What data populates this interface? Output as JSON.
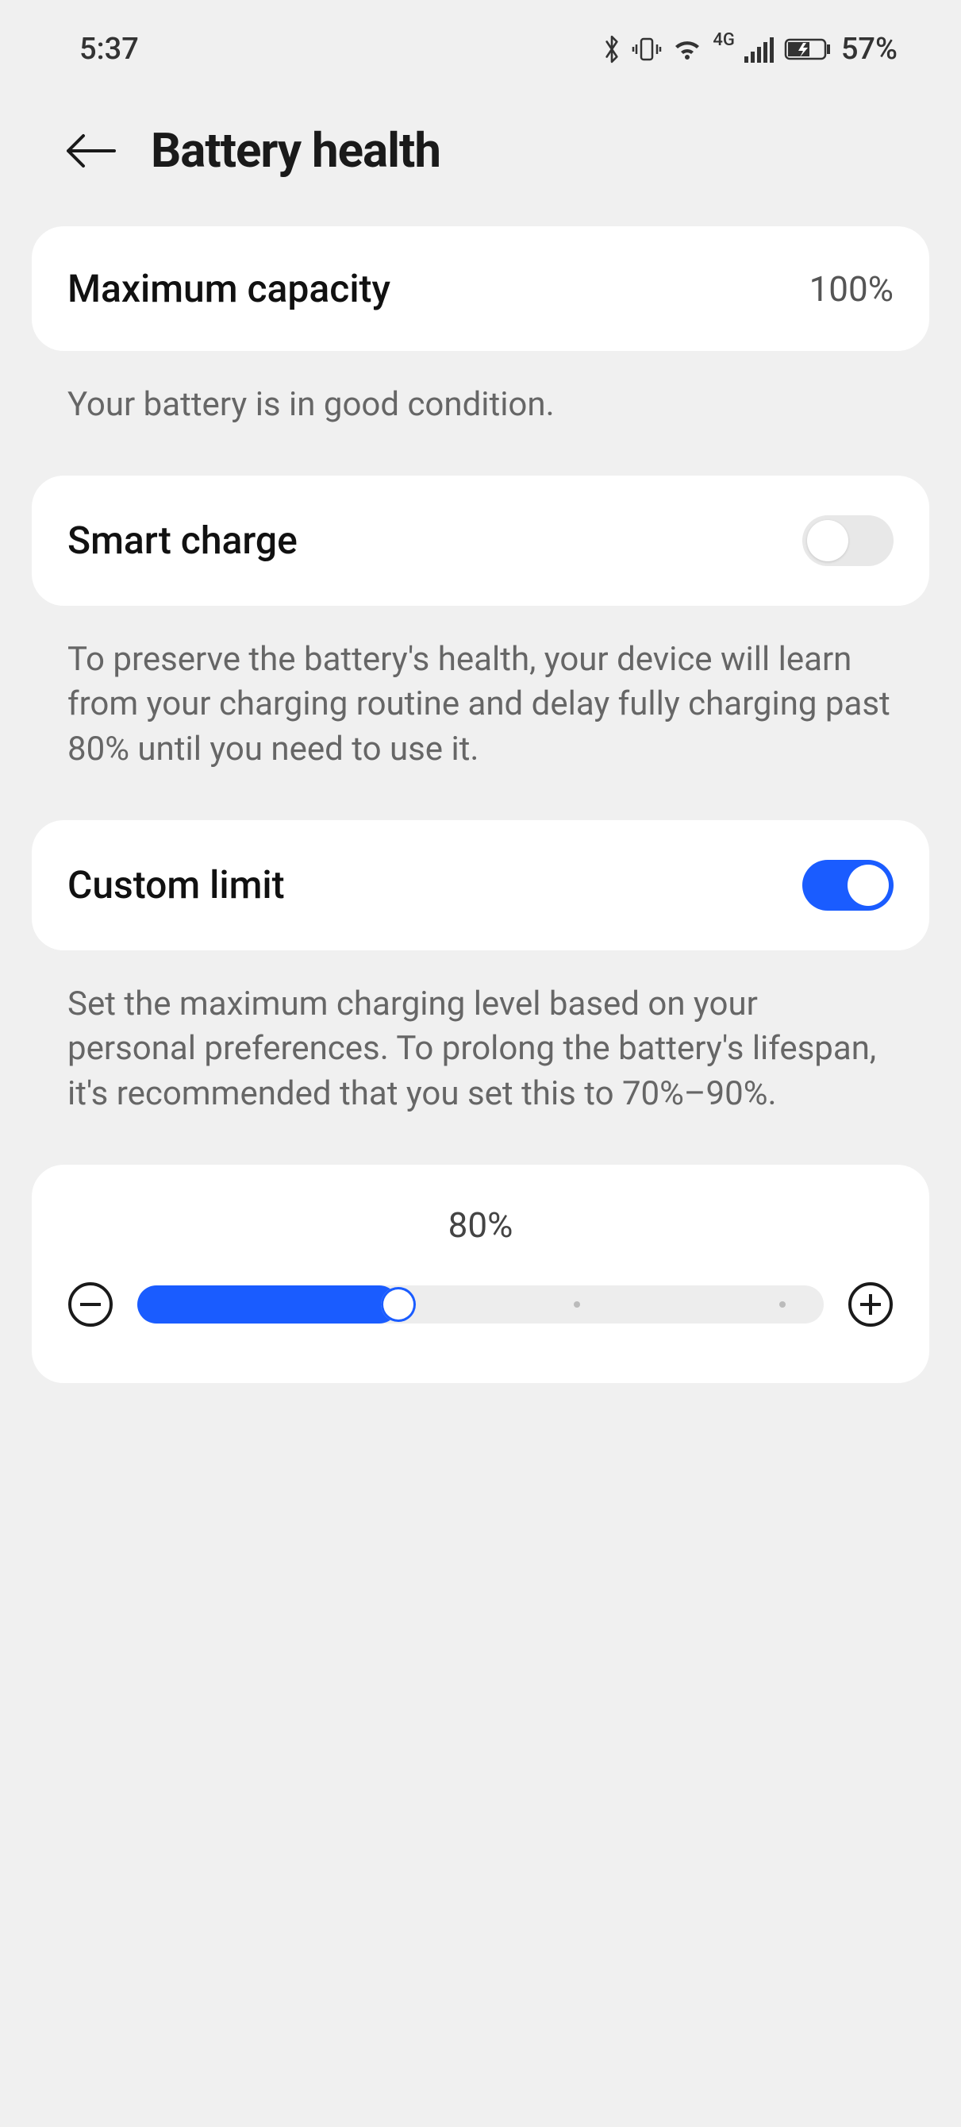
{
  "status": {
    "time": "5:37",
    "battery_percent": "57%",
    "network_label": "4G"
  },
  "header": {
    "title": "Battery health"
  },
  "max_capacity": {
    "label": "Maximum capacity",
    "value": "100%",
    "desc": "Your battery is in good condition."
  },
  "smart_charge": {
    "label": "Smart charge",
    "enabled": false,
    "desc": "To preserve the battery's health, your device will learn from your charging routine and delay fully charging past 80% until you need to use it."
  },
  "custom_limit": {
    "label": "Custom limit",
    "enabled": true,
    "desc": "Set the maximum charging level based on your personal preferences. To prolong the battery's lifespan, it's recommended that you set this to 70%–90%.",
    "slider_value": "80%"
  }
}
